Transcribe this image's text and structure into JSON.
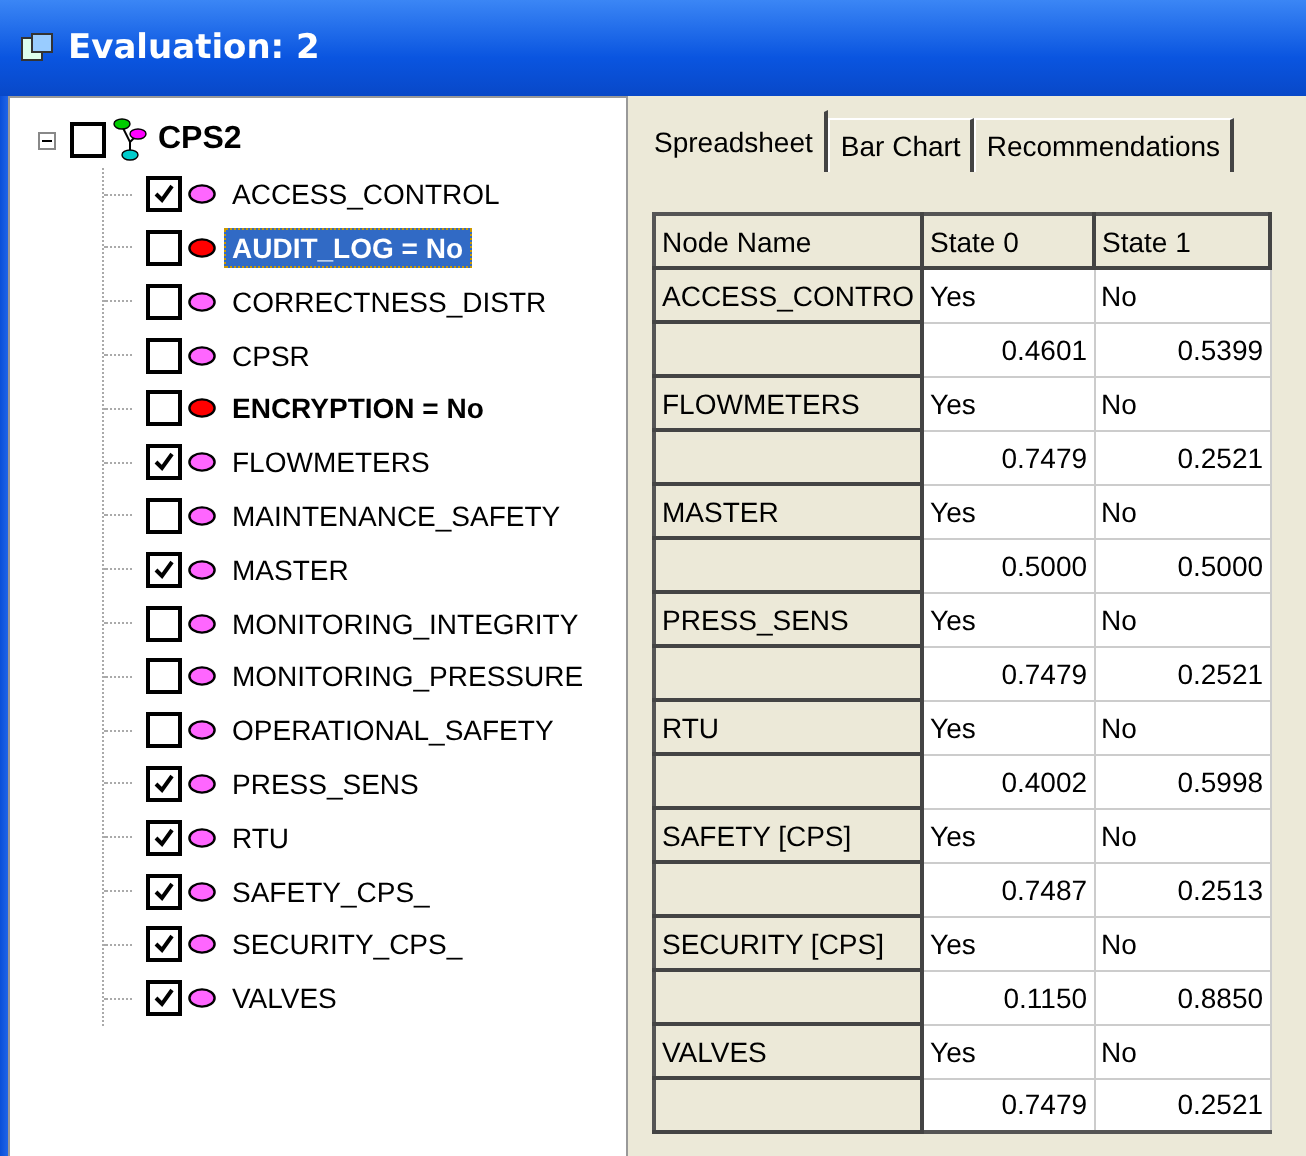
{
  "window": {
    "title": "Evaluation: 2"
  },
  "tree": {
    "root": {
      "label": "CPS2",
      "expanded": true,
      "checked": false,
      "children": [
        {
          "label": "ACCESS_CONTROL",
          "checked": true,
          "color": "#ff66ff",
          "evidence": false,
          "selected": false
        },
        {
          "label": "AUDIT_LOG = No",
          "checked": false,
          "color": "#ff0000",
          "evidence": true,
          "selected": true
        },
        {
          "label": "CORRECTNESS_DISTR",
          "checked": false,
          "color": "#ff66ff",
          "evidence": false,
          "selected": false
        },
        {
          "label": "CPSR",
          "checked": false,
          "color": "#ff66ff",
          "evidence": false,
          "selected": false
        },
        {
          "label": "ENCRYPTION = No",
          "checked": false,
          "color": "#ff0000",
          "evidence": true,
          "selected": false
        },
        {
          "label": "FLOWMETERS",
          "checked": true,
          "color": "#ff66ff",
          "evidence": false,
          "selected": false
        },
        {
          "label": "MAINTENANCE_SAFETY",
          "checked": false,
          "color": "#ff66ff",
          "evidence": false,
          "selected": false
        },
        {
          "label": "MASTER",
          "checked": true,
          "color": "#ff66ff",
          "evidence": false,
          "selected": false
        },
        {
          "label": "MONITORING_INTEGRITY",
          "checked": false,
          "color": "#ff66ff",
          "evidence": false,
          "selected": false
        },
        {
          "label": "MONITORING_PRESSURE",
          "checked": false,
          "color": "#ff66ff",
          "evidence": false,
          "selected": false
        },
        {
          "label": "OPERATIONAL_SAFETY",
          "checked": false,
          "color": "#ff66ff",
          "evidence": false,
          "selected": false
        },
        {
          "label": "PRESS_SENS",
          "checked": true,
          "color": "#ff66ff",
          "evidence": false,
          "selected": false
        },
        {
          "label": "RTU",
          "checked": true,
          "color": "#ff66ff",
          "evidence": false,
          "selected": false
        },
        {
          "label": "SAFETY_CPS_",
          "checked": true,
          "color": "#ff66ff",
          "evidence": false,
          "selected": false
        },
        {
          "label": "SECURITY_CPS_",
          "checked": true,
          "color": "#ff66ff",
          "evidence": false,
          "selected": false
        },
        {
          "label": "VALVES",
          "checked": true,
          "color": "#ff66ff",
          "evidence": false,
          "selected": false
        }
      ]
    }
  },
  "tabs": [
    {
      "label": "Spreadsheet",
      "selected": true
    },
    {
      "label": "Bar Chart",
      "selected": false
    },
    {
      "label": "Recommendations",
      "selected": false
    }
  ],
  "table": {
    "columns": [
      "Node Name",
      "State 0",
      "State 1"
    ],
    "nodes": [
      {
        "name": "ACCESS_CONTRO",
        "states": [
          "Yes",
          "No"
        ],
        "values": [
          "0.4601",
          "0.5399"
        ]
      },
      {
        "name": "FLOWMETERS",
        "states": [
          "Yes",
          "No"
        ],
        "values": [
          "0.7479",
          "0.2521"
        ]
      },
      {
        "name": "MASTER",
        "states": [
          "Yes",
          "No"
        ],
        "values": [
          "0.5000",
          "0.5000"
        ]
      },
      {
        "name": "PRESS_SENS",
        "states": [
          "Yes",
          "No"
        ],
        "values": [
          "0.7479",
          "0.2521"
        ]
      },
      {
        "name": "RTU",
        "states": [
          "Yes",
          "No"
        ],
        "values": [
          "0.4002",
          "0.5998"
        ]
      },
      {
        "name": "SAFETY [CPS]",
        "states": [
          "Yes",
          "No"
        ],
        "values": [
          "0.7487",
          "0.2513"
        ]
      },
      {
        "name": "SECURITY [CPS]",
        "states": [
          "Yes",
          "No"
        ],
        "values": [
          "0.1150",
          "0.8850"
        ]
      },
      {
        "name": "VALVES",
        "states": [
          "Yes",
          "No"
        ],
        "values": [
          "0.7479",
          "0.2521"
        ]
      }
    ]
  }
}
